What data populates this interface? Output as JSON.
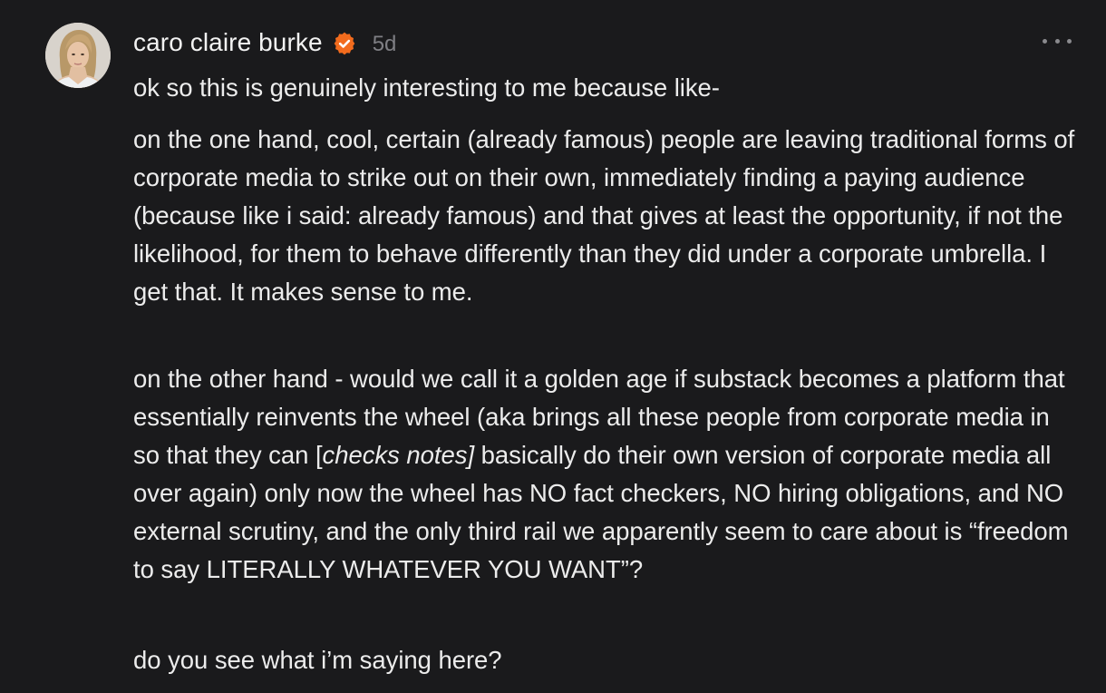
{
  "post": {
    "author": {
      "name": "caro claire burke",
      "verified_icon": "verified-badge-icon",
      "avatar_icon": "avatar-photo"
    },
    "timestamp": "5d",
    "more_icon": "more-horizontal-icon",
    "body": {
      "p1": "ok so this is genuinely interesting to me because like-",
      "p2": "on the one hand, cool, certain (already famous) people are leaving traditional forms of corporate media to strike out on their own, immediately finding a paying audience (because like i said: already famous) and that gives at least the opportunity, if not the likelihood, for them to behave differently than they did under a corporate umbrella. I get that. It makes sense to me.",
      "p3_before": "on the other hand - would we call it a golden age if substack becomes a platform that essentially reinvents the wheel (aka brings all these people from corporate media in so that they can [",
      "p3_italic": "checks notes]",
      "p3_after": " basically do their own version of corporate media all over again) only now the wheel has NO fact checkers, NO hiring obligations, and NO external scrutiny, and the only third rail we apparently seem to care about is “freedom to say LITERALLY WHATEVER YOU WANT”?",
      "p4": "do you see what i’m saying here?"
    }
  },
  "colors": {
    "background": "#1a1a1c",
    "text": "#ececec",
    "muted": "#7f7f84",
    "verified": "#f26b1d"
  }
}
